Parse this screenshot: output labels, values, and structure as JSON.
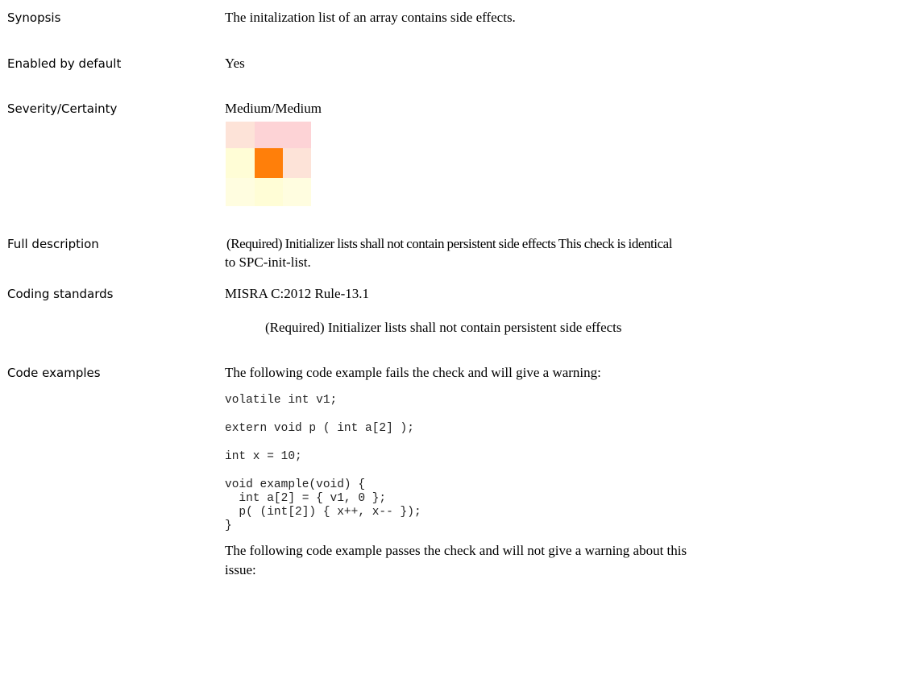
{
  "rows": {
    "synopsis": {
      "label": "Synopsis",
      "value": "The initalization list of an array contains side effects."
    },
    "enabled": {
      "label": "Enabled by default",
      "value": "Yes"
    },
    "severity": {
      "label": "Severity/Certainty",
      "value": "Medium/Medium"
    },
    "full_description": {
      "label": "Full description",
      "line1": "(Required) Initializer lists shall not contain persistent side effects This check is identical",
      "line2": "to SPC-init-list."
    },
    "coding_standards": {
      "label": "Coding standards",
      "value": "MISRA C:2012 Rule-13.1",
      "detail": "(Required) Initializer lists shall not contain persistent side effects"
    },
    "code_examples": {
      "label": "Code examples",
      "intro_fail": "The following code example fails the check and will give a warning:",
      "code_lines": [
        "volatile int v1;",
        "extern void p ( int a[2] );",
        "int x = 10;",
        "void example(void) {",
        "  int a[2] = { v1, 0 };",
        "  p( (int[2]) { x++, x-- });",
        "}"
      ],
      "intro_pass_line1": "The following code example passes the check and will not give a warning about this",
      "intro_pass_line2": "issue:"
    }
  },
  "severity_grid": {
    "rows": 3,
    "cols": 3,
    "colors": [
      [
        "#fde3d8",
        "#fdd3d6",
        "#fdd3d6"
      ],
      [
        "#fffdd6",
        "#ff7f0a",
        "#fde3d8"
      ],
      [
        "#fffde0",
        "#fffdd6",
        "#fffde0"
      ]
    ],
    "selected": "Medium/Medium"
  }
}
